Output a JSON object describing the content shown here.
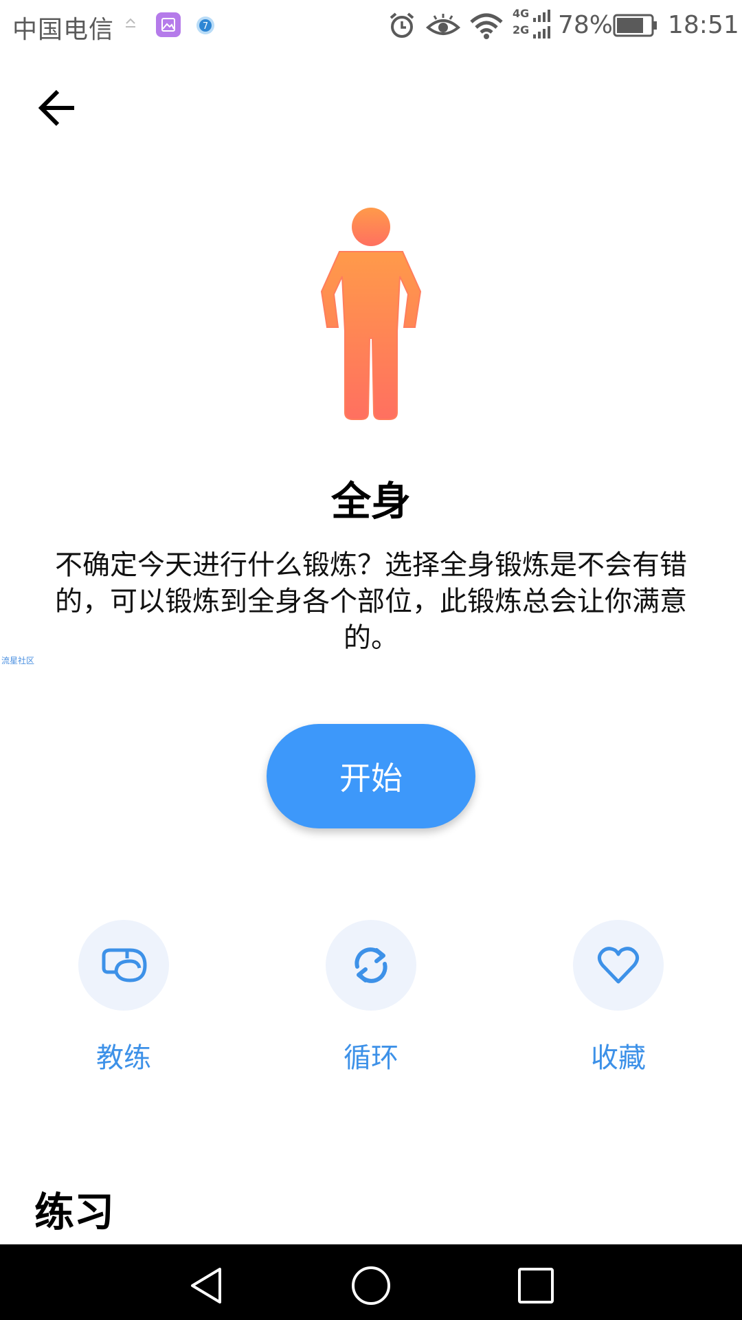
{
  "status_bar": {
    "carrier": "中国电信",
    "net_top": "4G",
    "net_bottom": "2G",
    "battery_percent": "78%",
    "time": "18:51",
    "icons": [
      "upload-icon",
      "gallery-app-icon",
      "notification-badge-icon",
      "alarm-icon",
      "eye-comfort-icon",
      "wifi-icon",
      "signal-icon",
      "battery-icon"
    ]
  },
  "header": {
    "back_icon": "arrow-left-icon"
  },
  "hero": {
    "figure_icon": "standing-person-icon",
    "figure_color": "#ff8a55",
    "title": "全身",
    "description": "不确定今天进行什么锻炼？选择全身锻炼是不会有错的，可以锻炼到全身各个部位，此锻炼总会让你满意的。"
  },
  "watermark": "流星社区",
  "start_button": {
    "label": "开始",
    "color": "#3d98fa"
  },
  "actions": [
    {
      "label": "教练",
      "icon": "whistle-icon"
    },
    {
      "label": "循环",
      "icon": "repeat-icon"
    },
    {
      "label": "收藏",
      "icon": "heart-icon"
    }
  ],
  "accent_color": "#3d91e8",
  "section": {
    "title": "练习"
  },
  "nav": {
    "icons": [
      "back-triangle-icon",
      "home-circle-icon",
      "recents-square-icon"
    ]
  }
}
